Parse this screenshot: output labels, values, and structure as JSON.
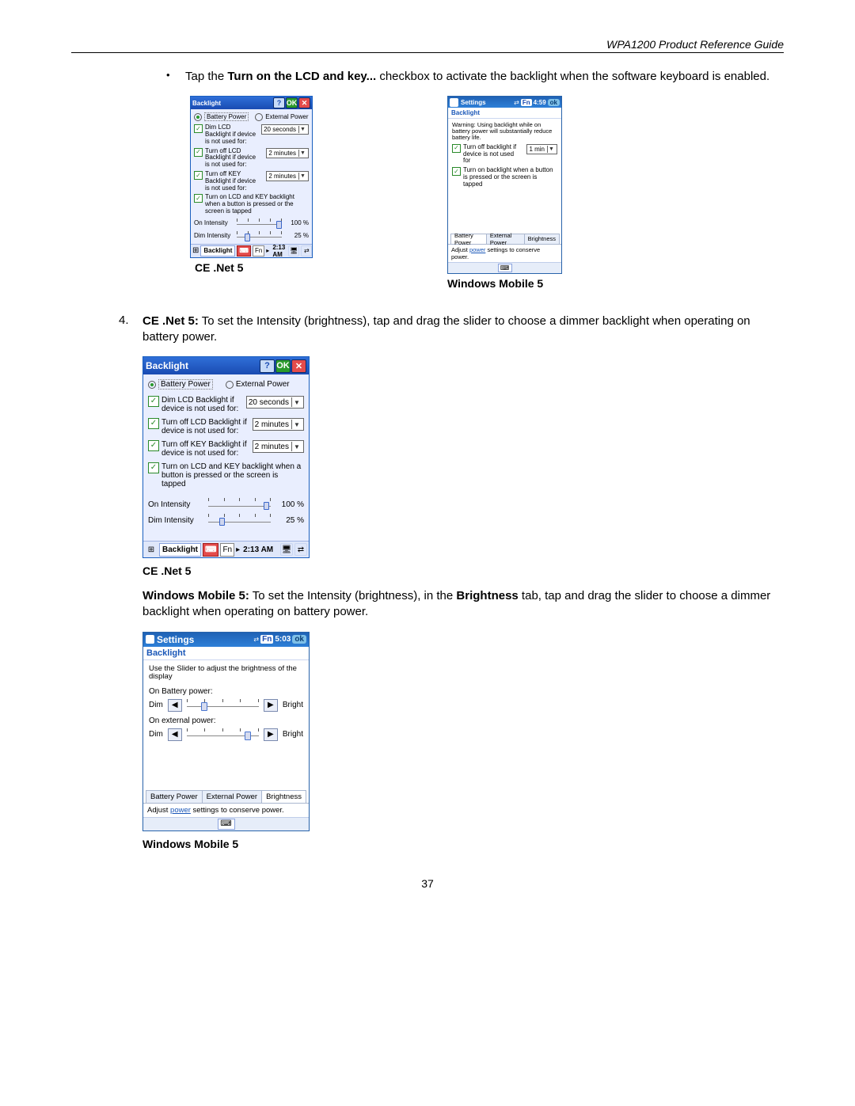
{
  "header": {
    "guide": "WPA1200 Product Reference Guide"
  },
  "bullet": {
    "pre": "Tap the ",
    "bold": "Turn on the LCD and key...",
    "post": " checkbox to activate the backlight when the software keyboard is enabled."
  },
  "fig_small": {
    "ce": {
      "title": "Backlight",
      "help": "?",
      "ok": "OK",
      "close": "✕",
      "radio_battery": "Battery Power",
      "radio_external": "External Power",
      "opt1_label": "Dim LCD Backlight if device is not used for:",
      "opt1_value": "20 seconds",
      "opt2_label": "Turn off LCD Backlight if device is not used for:",
      "opt2_value": "2 minutes",
      "opt3_label": "Turn off KEY Backlight if device is not used for:",
      "opt3_value": "2 minutes",
      "opt4_label": "Turn on LCD and KEY backlight when a button is pressed or the screen is tapped",
      "on_intensity_lbl": "On Intensity",
      "on_intensity_val": "100 %",
      "dim_intensity_lbl": "Dim Intensity",
      "dim_intensity_val": "25 %",
      "taskbar_app": "Backlight",
      "fn": "Fn",
      "time": "2:13 AM"
    },
    "wm": {
      "title": "Settings",
      "fn": "Fn",
      "time": "4:59",
      "ok": "ok",
      "sub": "Backlight",
      "warn": "Warning: Using backlight while on battery power will substantially reduce battery life.",
      "opt1_label": "Turn off backlight if device is not used for",
      "opt1_value": "1 min",
      "opt2_label": "Turn on backlight when a button is pressed or the screen is tapped",
      "tabs": [
        "Battery Power",
        "External Power",
        "Brightness"
      ],
      "foot_pre": "Adjust ",
      "foot_link": "power",
      "foot_post": " settings to conserve power."
    },
    "ce_caption": "CE .Net 5",
    "wm_caption": "Windows Mobile 5"
  },
  "step4": {
    "num": "4.",
    "bold": "CE .Net 5:",
    "text": " To set the Intensity (brightness), tap and drag the slider to choose a dimmer backlight when operating on battery power."
  },
  "fig_large_ce": {
    "caption": "CE .Net 5"
  },
  "para_wm5": {
    "bold1": "Windows Mobile 5:",
    "mid": " To set the Intensity (brightness), in the ",
    "bold2": "Brightness",
    "post": " tab, tap and drag the slider to choose a dimmer backlight when operating on battery power."
  },
  "fig_wm_bright": {
    "title": "Settings",
    "fn": "Fn",
    "time": "5:03",
    "ok": "ok",
    "sub": "Backlight",
    "instr": "Use the Slider to adjust the brightness of the display",
    "on_batt": "On Battery power:",
    "on_ext": "On external power:",
    "dim": "Dim",
    "bright": "Bright",
    "tabs": [
      "Battery Power",
      "External Power",
      "Brightness"
    ],
    "foot_pre": "Adjust ",
    "foot_link": "power",
    "foot_post": " settings to conserve power.",
    "caption": "Windows Mobile 5"
  },
  "page_num": "37"
}
